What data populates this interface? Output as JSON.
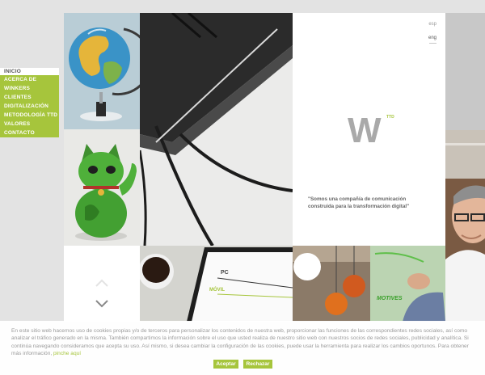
{
  "nav": {
    "items": [
      {
        "label": "INICIO",
        "active": true
      },
      {
        "label": "ACERCA DE"
      },
      {
        "label": "WINKERS"
      },
      {
        "label": "CLIENTES"
      },
      {
        "label": "DIGITALIZACIÓN"
      },
      {
        "label": "METODOLOGÍA TTD"
      },
      {
        "label": "VALORES"
      },
      {
        "label": "CONTACTO"
      }
    ]
  },
  "brand": {
    "logo_letter": "W",
    "logo_sup": "TTD",
    "lang_esp": "esp",
    "lang_eng": "eng",
    "tagline_line1": "\"Somos una compañía de comunicación",
    "tagline_line2": "construida para la transformación digital\""
  },
  "tablet": {
    "label_pc": "PC",
    "label_movil": "MÓVIL"
  },
  "glass": {
    "label": "MOTIVES"
  },
  "cookie": {
    "text": "En este sitio web hacemos uso de cookies propias y/o de terceros para personalizar los contenidos de nuestra web, proporcionar las funciones de las correspondientes redes sociales, así como analizar el tráfico generado en la misma. También compartimos la información sobre el uso que usted realiza de nuestro sitio web con nuestros socios de redes sociales, publicidad y analítica. Si continúa navegando consideramos que acepta su uso. Así mismo, si desea cambiar la configuración de las cookies, puede usar la herramienta para realizar los cambios oportunos. Para obtener más información, ",
    "link": "pinche aquí",
    "accept": "Aceptar",
    "reject": "Rechazar"
  },
  "colors": {
    "accent": "#a6c53c",
    "background": "#e3e3e3"
  }
}
